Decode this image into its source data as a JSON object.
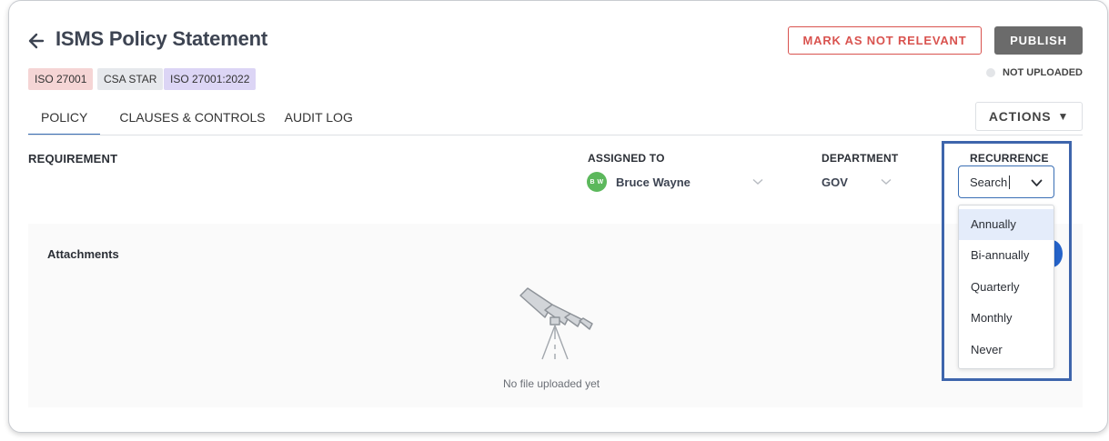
{
  "header": {
    "title": "ISMS Policy Statement",
    "tags": [
      "ISO 27001",
      "CSA STAR",
      "ISO 27001:2022"
    ],
    "mark_not_relevant_label": "MARK AS NOT RELEVANT",
    "publish_label": "PUBLISH",
    "status": "NOT UPLOADED"
  },
  "tabs": [
    {
      "label": "POLICY",
      "active": true
    },
    {
      "label": "CLAUSES & CONTROLS",
      "active": false
    },
    {
      "label": "AUDIT LOG",
      "active": false
    }
  ],
  "actions_label": "ACTIONS",
  "columns": {
    "requirement": "REQUIREMENT",
    "assigned_to": "ASSIGNED TO",
    "department": "DEPARTMENT",
    "recurrence": "RECURRENCE"
  },
  "assignee": {
    "initials": "B W",
    "name": "Bruce Wayne"
  },
  "department_value": "GOV",
  "recurrence": {
    "search_value": "Search",
    "options": [
      "Annually",
      "Bi-annually",
      "Quarterly",
      "Monthly",
      "Never"
    ],
    "highlighted": "Annually"
  },
  "attachments": {
    "label": "Attachments",
    "empty_text": "No file uploaded yet"
  },
  "colors": {
    "accent": "#3a6fb5",
    "danger": "#d9534f",
    "publish_bg": "#6b6b6b",
    "highlight_box": "#3e65ac",
    "avatar_bg": "#5cb85c"
  }
}
